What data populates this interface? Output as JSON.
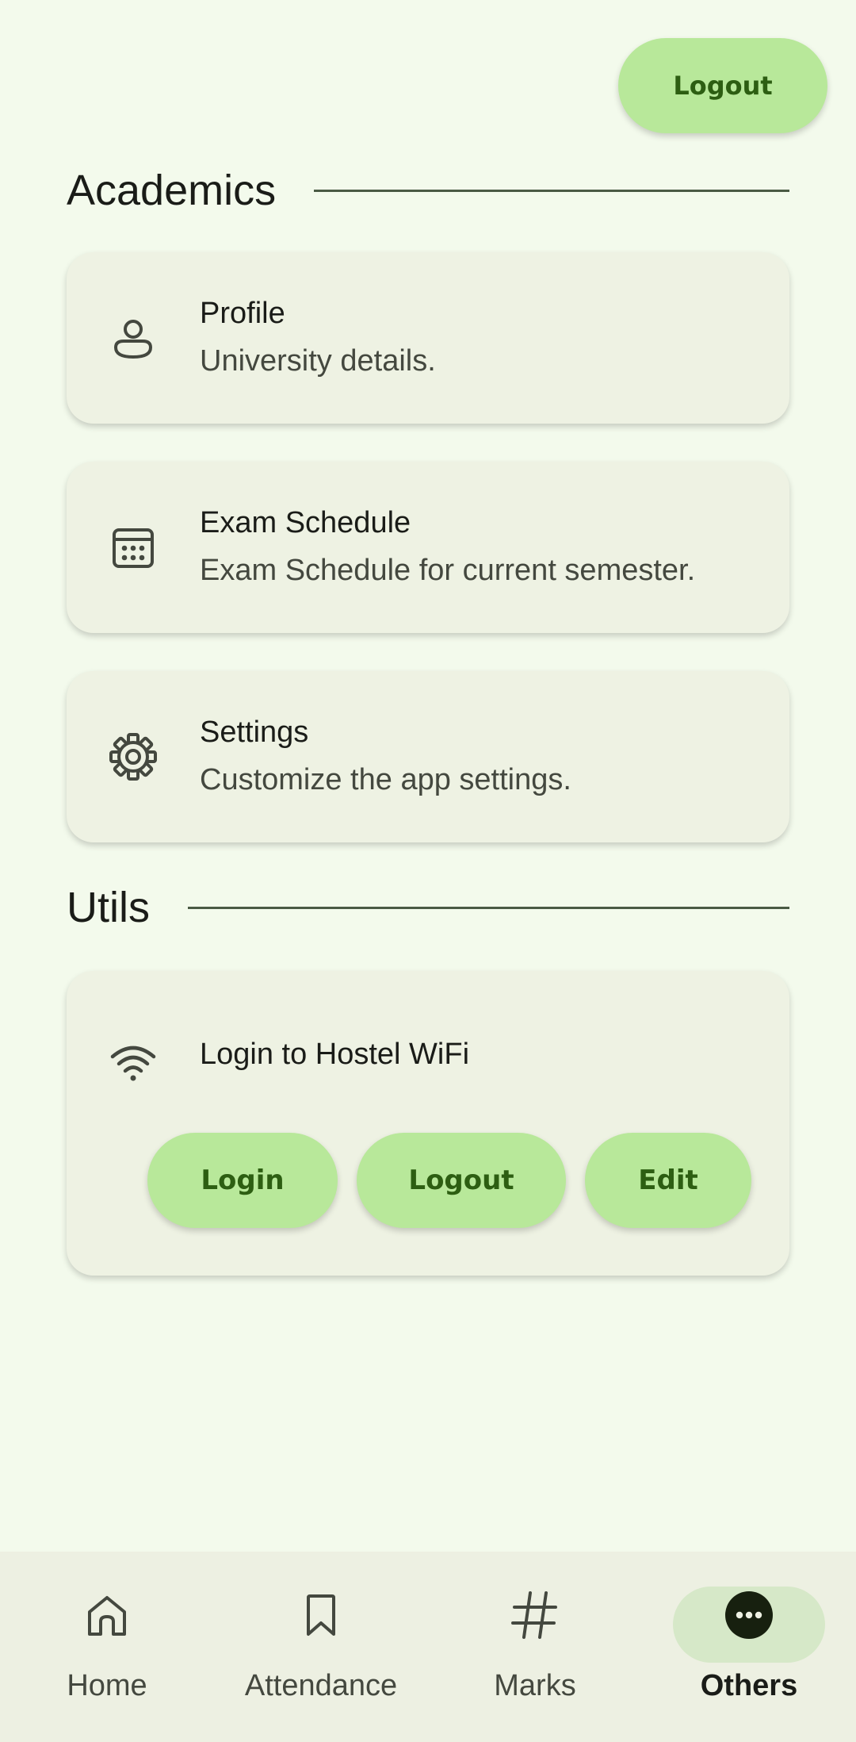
{
  "header": {
    "logout_label": "Logout"
  },
  "academics": {
    "title": "Academics",
    "items": [
      {
        "title": "Profile",
        "subtitle": "University details.",
        "icon": "person-icon"
      },
      {
        "title": "Exam Schedule",
        "subtitle": "Exam Schedule for current semester.",
        "icon": "calendar-icon"
      },
      {
        "title": "Settings",
        "subtitle": "Customize the app settings.",
        "icon": "gear-icon"
      }
    ]
  },
  "utils": {
    "title": "Utils",
    "wifi": {
      "title": "Login to Hostel WiFi",
      "icon": "wifi-icon",
      "login_label": "Login",
      "logout_label": "Logout",
      "edit_label": "Edit"
    }
  },
  "bottom_nav": {
    "items": [
      {
        "label": "Home",
        "icon": "home-icon"
      },
      {
        "label": "Attendance",
        "icon": "bookmark-icon"
      },
      {
        "label": "Marks",
        "icon": "hash-icon"
      },
      {
        "label": "Others",
        "icon": "more-icon",
        "active": true
      }
    ]
  },
  "colors": {
    "background": "#F3FAEC",
    "card": "#EEF2E3",
    "button": "#B8E89A",
    "button_text": "#2D5E12",
    "nav_bar": "#EDF0E2",
    "active_indicator": "#D6E8C8"
  }
}
